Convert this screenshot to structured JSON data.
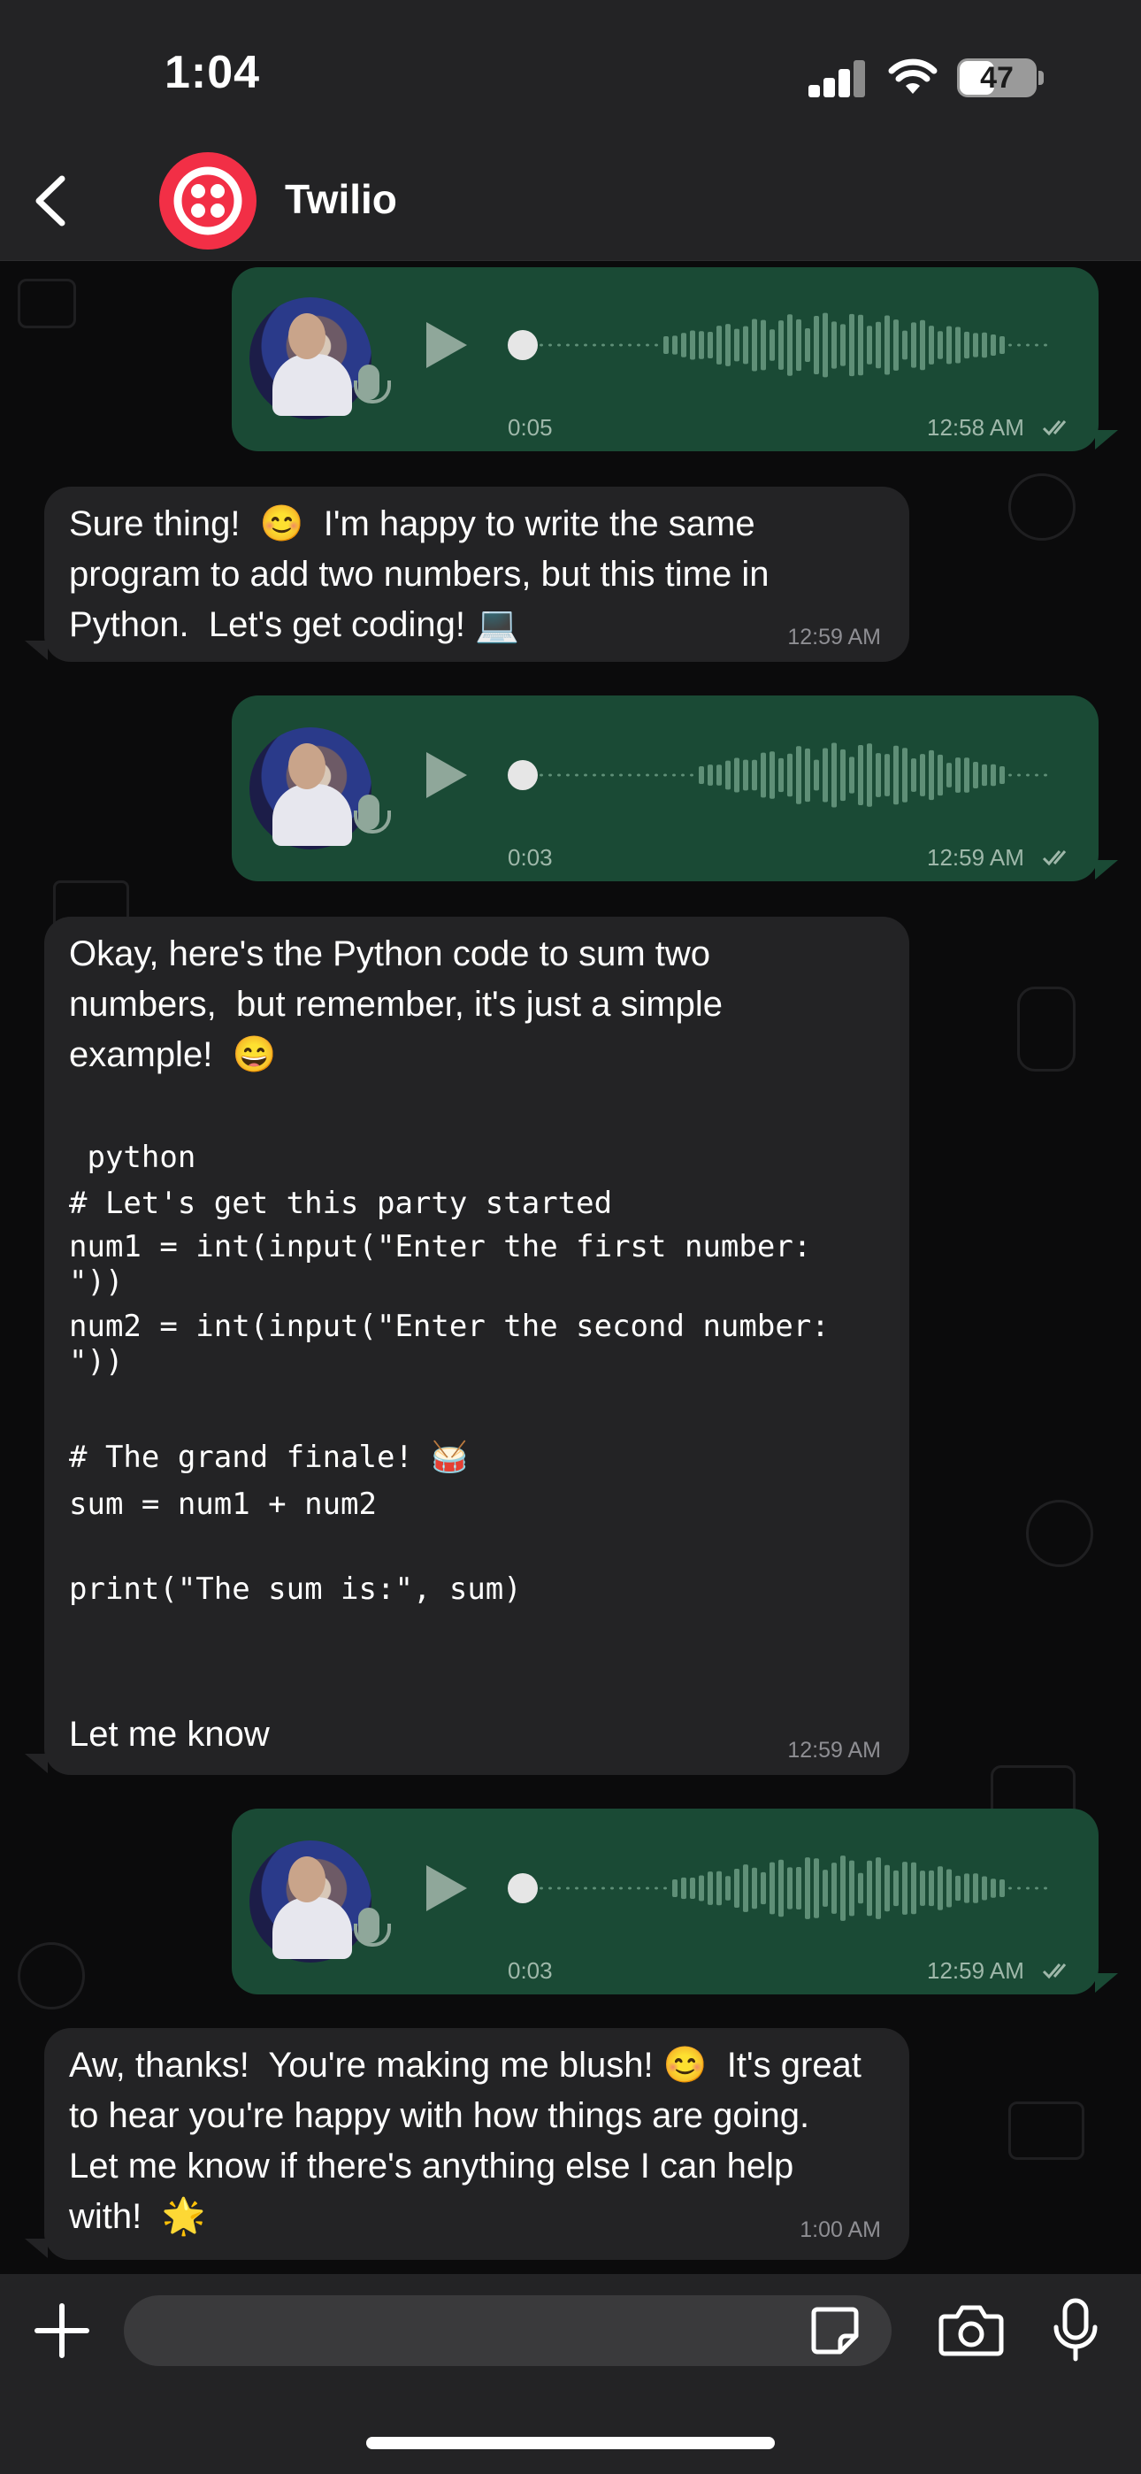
{
  "status_bar": {
    "time": "1:04",
    "battery": "47",
    "battery_level": 0.47
  },
  "header": {
    "back_icon": "chevron-left-icon",
    "contact_name": "Twilio",
    "avatar_icon": "twilio-logo-icon",
    "brand_color": "#f22f46"
  },
  "colors": {
    "outgoing_bubble": "#1a4a35",
    "incoming_bubble": "#232325",
    "background": "#0b0b0c"
  },
  "messages": [
    {
      "type": "voice",
      "direction": "outgoing",
      "duration": "0:05",
      "time": "12:58 AM",
      "read_icon": "double-check-icon"
    },
    {
      "type": "text",
      "direction": "incoming",
      "text": "Sure thing!  😊  I'm happy to write the same program to add two numbers, but this time in Python.  Let's get coding! 💻",
      "time": "12:59 AM"
    },
    {
      "type": "voice",
      "direction": "outgoing",
      "duration": "0:03",
      "time": "12:59 AM",
      "read_icon": "double-check-icon"
    },
    {
      "type": "code",
      "direction": "incoming",
      "intro": "Okay, here's the Python code to sum two numbers,  but remember, it's just a simple example!  😄",
      "code_lines": [
        " python",
        "# Let's get this party started",
        "num1 = int(input(\"Enter the first number:",
        "\"))",
        "num2 = int(input(\"Enter the second number:",
        "\"))",
        "",
        "# The grand finale! 🥁",
        "sum = num1 + num2",
        "",
        "print(\"The sum is:\", sum)"
      ],
      "outro": "Let me know",
      "time": "12:59 AM"
    },
    {
      "type": "voice",
      "direction": "outgoing",
      "duration": "0:03",
      "time": "12:59 AM",
      "read_icon": "double-check-icon"
    },
    {
      "type": "text",
      "direction": "incoming",
      "text": "Aw, thanks!  You're making me blush! 😊  It's great to hear you're happy with how things are going.  Let me know if there's anything else I can help with!  🌟",
      "time": "1:00 AM"
    }
  ],
  "composer": {
    "plus_icon": "plus-icon",
    "sticker_icon": "sticker-icon",
    "camera_icon": "camera-icon",
    "mic_icon": "microphone-icon",
    "placeholder": ""
  }
}
